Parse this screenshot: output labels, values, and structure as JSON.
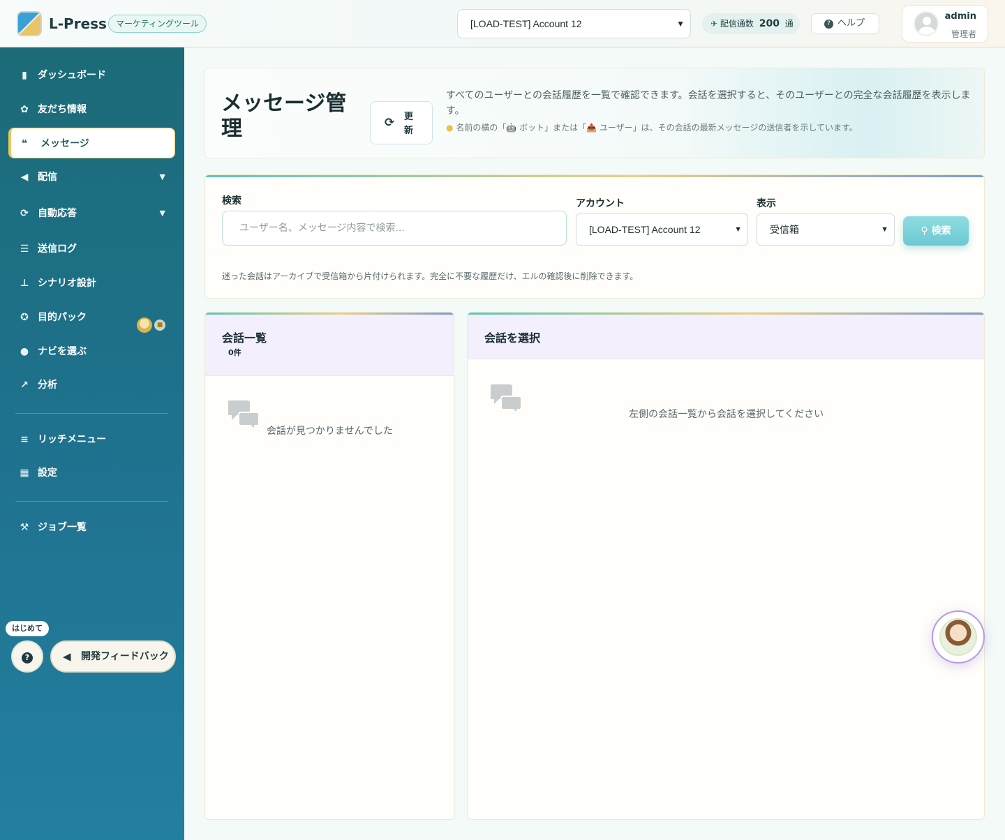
{
  "header": {
    "logo_text": "L-Press",
    "tag": "マーケティングツール",
    "account_select": "[LOAD-TEST] Account 12",
    "count_label": "配信通数",
    "count_value": "200",
    "count_unit": "通",
    "help_label": "ヘルプ",
    "user_name": "admin",
    "user_role": "管理者"
  },
  "sidebar": {
    "items": [
      {
        "label": "ダッシュボード",
        "icon": "bar-chart-icon"
      },
      {
        "label": "友だち情報",
        "icon": "friends-icon"
      },
      {
        "label": "メッセージ",
        "icon": "comments-icon"
      },
      {
        "label": "配信",
        "icon": "megaphone-icon"
      },
      {
        "label": "自動応答",
        "icon": "refresh-icon"
      },
      {
        "label": "送信ログ",
        "icon": "list-icon"
      },
      {
        "label": "シナリオ設計",
        "icon": "sitemap-icon"
      },
      {
        "label": "目的パック",
        "icon": "award-icon"
      },
      {
        "label": "ナビを選ぶ",
        "icon": "chat-bubble-icon"
      },
      {
        "label": "分析",
        "icon": "line-chart-icon"
      },
      {
        "label": "リッチメニュー",
        "icon": "menu-icon"
      },
      {
        "label": "設定",
        "icon": "settings-icon"
      },
      {
        "label": "ジョブ一覧",
        "icon": "hammer-icon"
      }
    ],
    "hajime": "はじめて",
    "feedback": "開発フィードバック"
  },
  "hero": {
    "title": "メッセージ管理",
    "refresh": "更新",
    "desc": "すべてのユーザーとの会話履歴を一覧で確認できます。会話を選択すると、そのユーザーとの完全な会話履歴を表示します。",
    "note": "名前の横の「🤖 ボット」または「📤 ユーザー」は、その会話の最新メッセージの送信者を示しています。"
  },
  "filter": {
    "search_label": "検索",
    "search_placeholder": "ユーザー名、メッセージ内容で検索...",
    "account_label": "アカウント",
    "account_value": "[LOAD-TEST] Account 12",
    "view_label": "表示",
    "view_value": "受信箱",
    "search_button": "検索",
    "note": "迷った会話はアーカイブで受信箱から片付けられます。完全に不要な履歴だけ、エルの確認後に削除できます。"
  },
  "list_panel": {
    "title": "会話一覧",
    "count": "0件",
    "empty": "会話が見つかりませんでした"
  },
  "detail_panel": {
    "title": "会話を選択",
    "empty": "左側の会話一覧から会話を選択してください"
  }
}
